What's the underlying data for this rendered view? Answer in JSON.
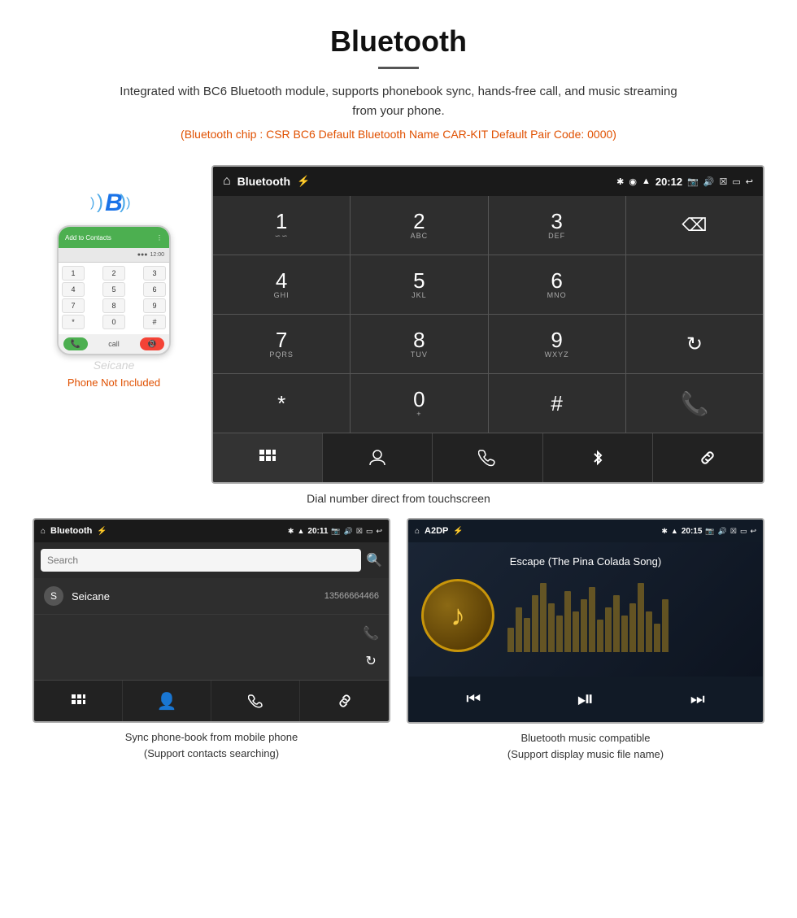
{
  "header": {
    "title": "Bluetooth",
    "description": "Integrated with BC6 Bluetooth module, supports phonebook sync, hands-free call, and music streaming from your phone.",
    "specs": "(Bluetooth chip : CSR BC6    Default Bluetooth Name CAR-KIT    Default Pair Code: 0000)"
  },
  "phone_side": {
    "not_included": "Phone Not Included",
    "watermark": "Seicane"
  },
  "car_screen_dial": {
    "status_bar": {
      "title": "Bluetooth",
      "time": "20:12"
    },
    "dial_keys": [
      {
        "num": "1",
        "sub": "∽∽"
      },
      {
        "num": "2",
        "sub": "ABC"
      },
      {
        "num": "3",
        "sub": "DEF"
      },
      {
        "num": "",
        "sub": ""
      },
      {
        "num": "4",
        "sub": "GHI"
      },
      {
        "num": "5",
        "sub": "JKL"
      },
      {
        "num": "6",
        "sub": "MNO"
      },
      {
        "num": "",
        "sub": ""
      },
      {
        "num": "7",
        "sub": "PQRS"
      },
      {
        "num": "8",
        "sub": "TUV"
      },
      {
        "num": "9",
        "sub": "WXYZ"
      },
      {
        "num": "",
        "sub": ""
      },
      {
        "num": "*",
        "sub": ""
      },
      {
        "num": "0",
        "sub": "+"
      },
      {
        "num": "#",
        "sub": ""
      },
      {
        "num": "",
        "sub": ""
      }
    ],
    "caption": "Dial number direct from touchscreen"
  },
  "phonebook_screen": {
    "status_bar": {
      "title": "Bluetooth",
      "time": "20:11"
    },
    "search_placeholder": "Search",
    "contacts": [
      {
        "letter": "S",
        "name": "Seicane",
        "number": "13566664466"
      }
    ],
    "caption_line1": "Sync phone-book from mobile phone",
    "caption_line2": "(Support contacts searching)"
  },
  "a2dp_screen": {
    "status_bar": {
      "title": "A2DP",
      "time": "20:15"
    },
    "song_title": "Escape (The Pina Colada Song)",
    "caption_line1": "Bluetooth music compatible",
    "caption_line2": "(Support display music file name)"
  },
  "icons": {
    "home": "⌂",
    "usb": "⚡",
    "bluetooth": "⚡",
    "camera": "📷",
    "volume": "🔊",
    "close": "✕",
    "window": "▭",
    "back": "↩",
    "search": "🔍",
    "person": "👤",
    "phone": "📞",
    "refresh": "↻",
    "grid": "⊞",
    "bt_sym": "Ƀ",
    "link": "🔗",
    "prev": "⏮",
    "playpause": "⏯",
    "next": "⏭",
    "signal": "▲",
    "wifi": "📶"
  },
  "eq_bars": [
    30,
    55,
    42,
    70,
    85,
    60,
    45,
    75,
    50,
    65,
    80,
    40,
    55,
    70,
    45,
    60,
    85,
    50,
    35,
    65
  ]
}
